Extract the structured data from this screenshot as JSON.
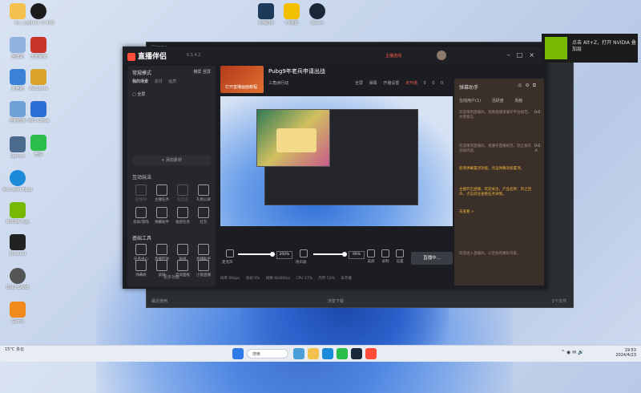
{
  "desktop": {
    "icons_left": [
      {
        "label": "tra"
      },
      {
        "label": "回收站"
      },
      {
        "label": "此电脑"
      },
      {
        "label": "控制面板"
      },
      {
        "label": "Lenovo"
      },
      {
        "label": "Microsoft Edge"
      },
      {
        "label": "NVIDIA App"
      },
      {
        "label": "Shortcut"
      },
      {
        "label": "GRID GAME"
      },
      {
        "label": "Game"
      }
    ],
    "icons_col2": [
      {
        "label": "Logitech G HUB"
      },
      {
        "label": "王者荣耀"
      },
      {
        "label": "WeGame"
      },
      {
        "label": "WPS Office"
      },
      {
        "label": "微信"
      }
    ],
    "icons_top": [
      {
        "label": "手柄助手"
      },
      {
        "label": "YY语音"
      },
      {
        "label": "Steam"
      }
    ]
  },
  "nvidia_toast": {
    "text": "点击 Alt+Z，打开 NVIDIA 叠加层"
  },
  "back_window": {
    "title": "Chrome",
    "footer_left": "最近使用",
    "footer_mid": "浏览下载",
    "footer_right": "1个文件"
  },
  "app": {
    "brand": "直播伴侣",
    "version": "6.5.4.2",
    "sidebar": {
      "scene_label": "常规模式",
      "top_tools": "横屏  竖屏",
      "tabs": [
        "我的场景",
        "素材",
        "画质"
      ],
      "active_tab": 0,
      "scene_item": "全屏",
      "add_source": "+ 添加素材",
      "interact_title": "互动玩法",
      "interact_tools": [
        {
          "label": "连线PK",
          "enabled": false
        },
        {
          "label": "主播任务",
          "enabled": true
        },
        {
          "label": "粉丝团",
          "enabled": false
        },
        {
          "label": "礼物公屏",
          "enabled": true
        },
        {
          "label": "投屏/游戏",
          "enabled": true
        },
        {
          "label": "弹幕助手",
          "enabled": true
        },
        {
          "label": "福袋任务",
          "enabled": true
        },
        {
          "label": "红包",
          "enabled": true
        }
      ],
      "basic_title": "基础工具",
      "basic_tools": [
        {
          "label": "任务中心"
        },
        {
          "label": "直播回放"
        },
        {
          "label": "贴纸"
        },
        {
          "label": "直播助手"
        },
        {
          "label": "弹幕姬"
        },
        {
          "label": "录屏"
        },
        {
          "label": "音效面板"
        },
        {
          "label": "小窗直播"
        }
      ],
      "more": "更多功能"
    },
    "stream": {
      "thumb_text": "打开直播画面教程",
      "title": "Pubg9年老兵申请出战",
      "category": "三角洲行动",
      "actions": [
        "全屏",
        "弹幕",
        "开播设置",
        "未开播"
      ],
      "counters": [
        "0",
        "0",
        "0"
      ]
    },
    "topbar": {
      "ping_label": "主播连线",
      "items": [
        "开播设置",
        "分享"
      ]
    },
    "controls": {
      "mic_label": "麦克风",
      "mic_value": "200%",
      "speaker_label": "扬声器",
      "speaker_value": "99%",
      "extra": [
        "美颜",
        "录制",
        "设置"
      ],
      "live_button": "直播中..."
    },
    "status": {
      "items": [
        "码率 0Kbps",
        "丢帧 0%",
        "帧数 60/60fps",
        "CPU 17%",
        "内存 53%",
        "未开播"
      ]
    },
    "right_panel": {
      "title": "弹幕助手",
      "tabs": [
        "在线用户(1)",
        "活跃度",
        "贡献"
      ],
      "messages": [
        {
          "text": "欢迎来到直播间，观看直播请遵守平台规范，文明发言。",
          "highlight": false
        },
        {
          "text": "欢迎来到直播间，请遵守直播规范，禁止发布违规内容。",
          "highlight": false
        },
        {
          "text": "新增弹幕置顶功能，点击弹幕添加置顶。",
          "highlight": true
        },
        {
          "text": "主播开启直播，欢迎关注，产品名称：风之回声，点击前往查看任务详情。",
          "highlight": true
        },
        {
          "text": "去查看 >",
          "highlight": true
        },
        {
          "text": "欢迎进入直播间，以后会有精彩内容。",
          "highlight": false
        }
      ],
      "side_counts": [
        "0.0",
        "0.0人"
      ]
    }
  },
  "taskbar": {
    "weather": "15°C 多云",
    "search": "搜索",
    "time": "19:53",
    "date": "2024/4/23"
  }
}
